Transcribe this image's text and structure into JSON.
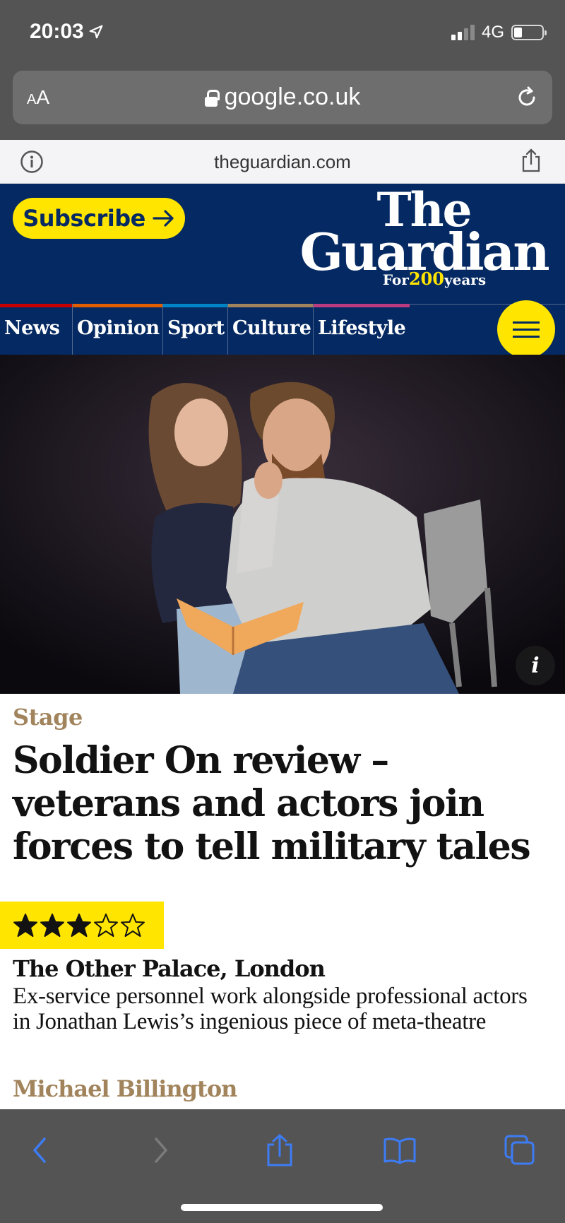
{
  "status_bar": {
    "time": "20:03",
    "network": "4G",
    "location_icon": "location-arrow-icon",
    "battery_level": 0.3
  },
  "browser": {
    "text_size_label_small": "A",
    "text_size_label_big": "A",
    "address": "google.co.uk",
    "site_domain": "theguardian.com"
  },
  "masthead": {
    "subscribe_label": "Subscribe",
    "logo_line1": "The",
    "logo_line2": "Guardian",
    "logo_for": "For",
    "logo_number": "200",
    "logo_years": "years",
    "brand_color": "#052962",
    "accent_color": "#ffe500"
  },
  "nav": {
    "items": [
      {
        "label": "News",
        "color": "#c70000"
      },
      {
        "label": "Opinion",
        "color": "#e05e00"
      },
      {
        "label": "Sport",
        "color": "#0084c6"
      },
      {
        "label": "Culture",
        "color": "#a1845c"
      },
      {
        "label": "Lifestyle",
        "color": "#bb3b80"
      }
    ],
    "menu_icon": "hamburger-icon"
  },
  "hero": {
    "info_label": "i"
  },
  "article": {
    "section": "Stage",
    "headline": "Soldier On review – veterans and actors join forces to tell military tales",
    "rating": 3,
    "rating_max": 5,
    "venue": "The Other Palace, London",
    "standfirst": "Ex-service personnel work alongside professional actors in Jonathan Lewis’s ingenious piece of meta-theatre",
    "byline": "Michael Billington"
  },
  "toolbar": {
    "back_icon": "chevron-left-icon",
    "forward_icon": "chevron-right-icon",
    "share_icon": "share-icon",
    "bookmarks_icon": "book-icon",
    "tabs_icon": "tabs-icon"
  }
}
